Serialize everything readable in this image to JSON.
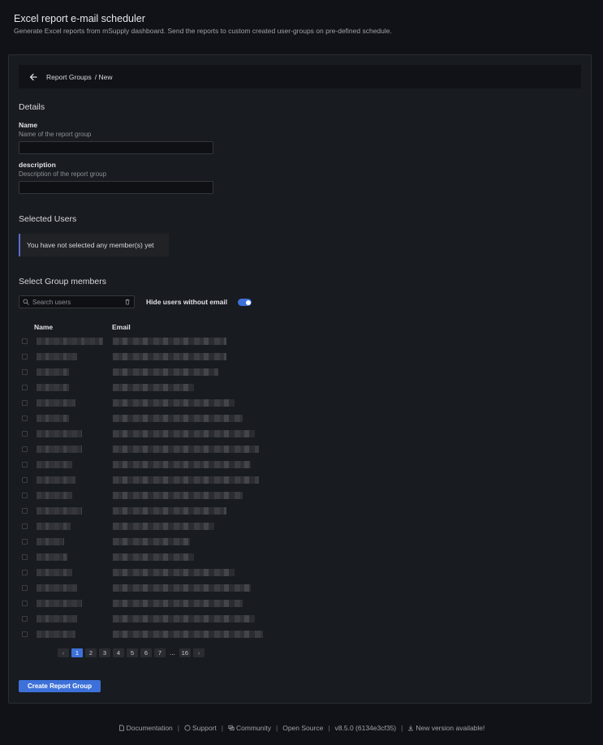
{
  "header": {
    "title": "Excel report e-mail scheduler",
    "subtitle": "Generate Excel reports from mSupply dashboard. Send the reports to custom created user-groups on pre-defined schedule."
  },
  "breadcrumb": {
    "parent": "Report Groups",
    "current": "/ New"
  },
  "details": {
    "heading": "Details",
    "name_label": "Name",
    "name_description": "Name of the report group",
    "name_value": "",
    "description_label": "description",
    "description_description": "Description of the report group",
    "description_value": ""
  },
  "selected_users": {
    "heading": "Selected Users",
    "empty_message": "You have not selected any member(s) yet"
  },
  "group_members": {
    "heading": "Select Group members",
    "search_placeholder": "Search users",
    "toggle_label": "Hide users without email",
    "toggle_on": true,
    "columns": [
      "Name",
      "Email"
    ]
  },
  "pagination": {
    "prev": "‹",
    "pages": [
      "1",
      "2",
      "3",
      "4",
      "5",
      "6",
      "7"
    ],
    "ellipsis": "...",
    "last": "16",
    "next": "›",
    "current": "1"
  },
  "actions": {
    "create_label": "Create Report Group"
  },
  "footer": {
    "documentation": "Documentation",
    "support": "Support",
    "community": "Community",
    "open_source": "Open Source",
    "version": "v8.5.0 (6134e3cf35)",
    "new_version": "New version available!"
  },
  "colors": {
    "background": "#111217",
    "panel": "#181b1f",
    "accent": "#3d71d9"
  }
}
